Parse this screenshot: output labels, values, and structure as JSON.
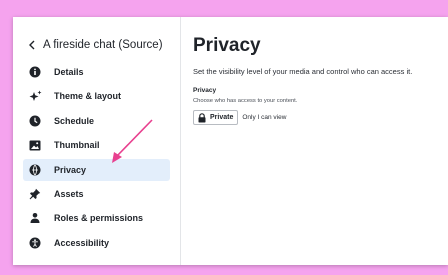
{
  "sidebar": {
    "back_title": "A fireside chat (Source)",
    "items": [
      {
        "label": "Details",
        "icon": "info-icon",
        "active": false
      },
      {
        "label": "Theme & layout",
        "icon": "sparkle-icon",
        "active": false
      },
      {
        "label": "Schedule",
        "icon": "clock-icon",
        "active": false
      },
      {
        "label": "Thumbnail",
        "icon": "image-icon",
        "active": false
      },
      {
        "label": "Privacy",
        "icon": "globe-lock-icon",
        "active": true
      },
      {
        "label": "Assets",
        "icon": "pin-icon",
        "active": false
      },
      {
        "label": "Roles & permissions",
        "icon": "person-icon",
        "active": false
      },
      {
        "label": "Accessibility",
        "icon": "accessibility-icon",
        "active": false
      }
    ]
  },
  "main": {
    "title": "Privacy",
    "description": "Set the visibility level of your media and control who can access it.",
    "privacy_section": {
      "label": "Privacy",
      "help": "Choose who has access to your content.",
      "button_label": "Private",
      "hint": "Only I can view"
    }
  },
  "colors": {
    "background": "#f5a3ee",
    "active_item": "#e3eefb",
    "arrow": "#e8408f",
    "text": "#1f2329"
  }
}
